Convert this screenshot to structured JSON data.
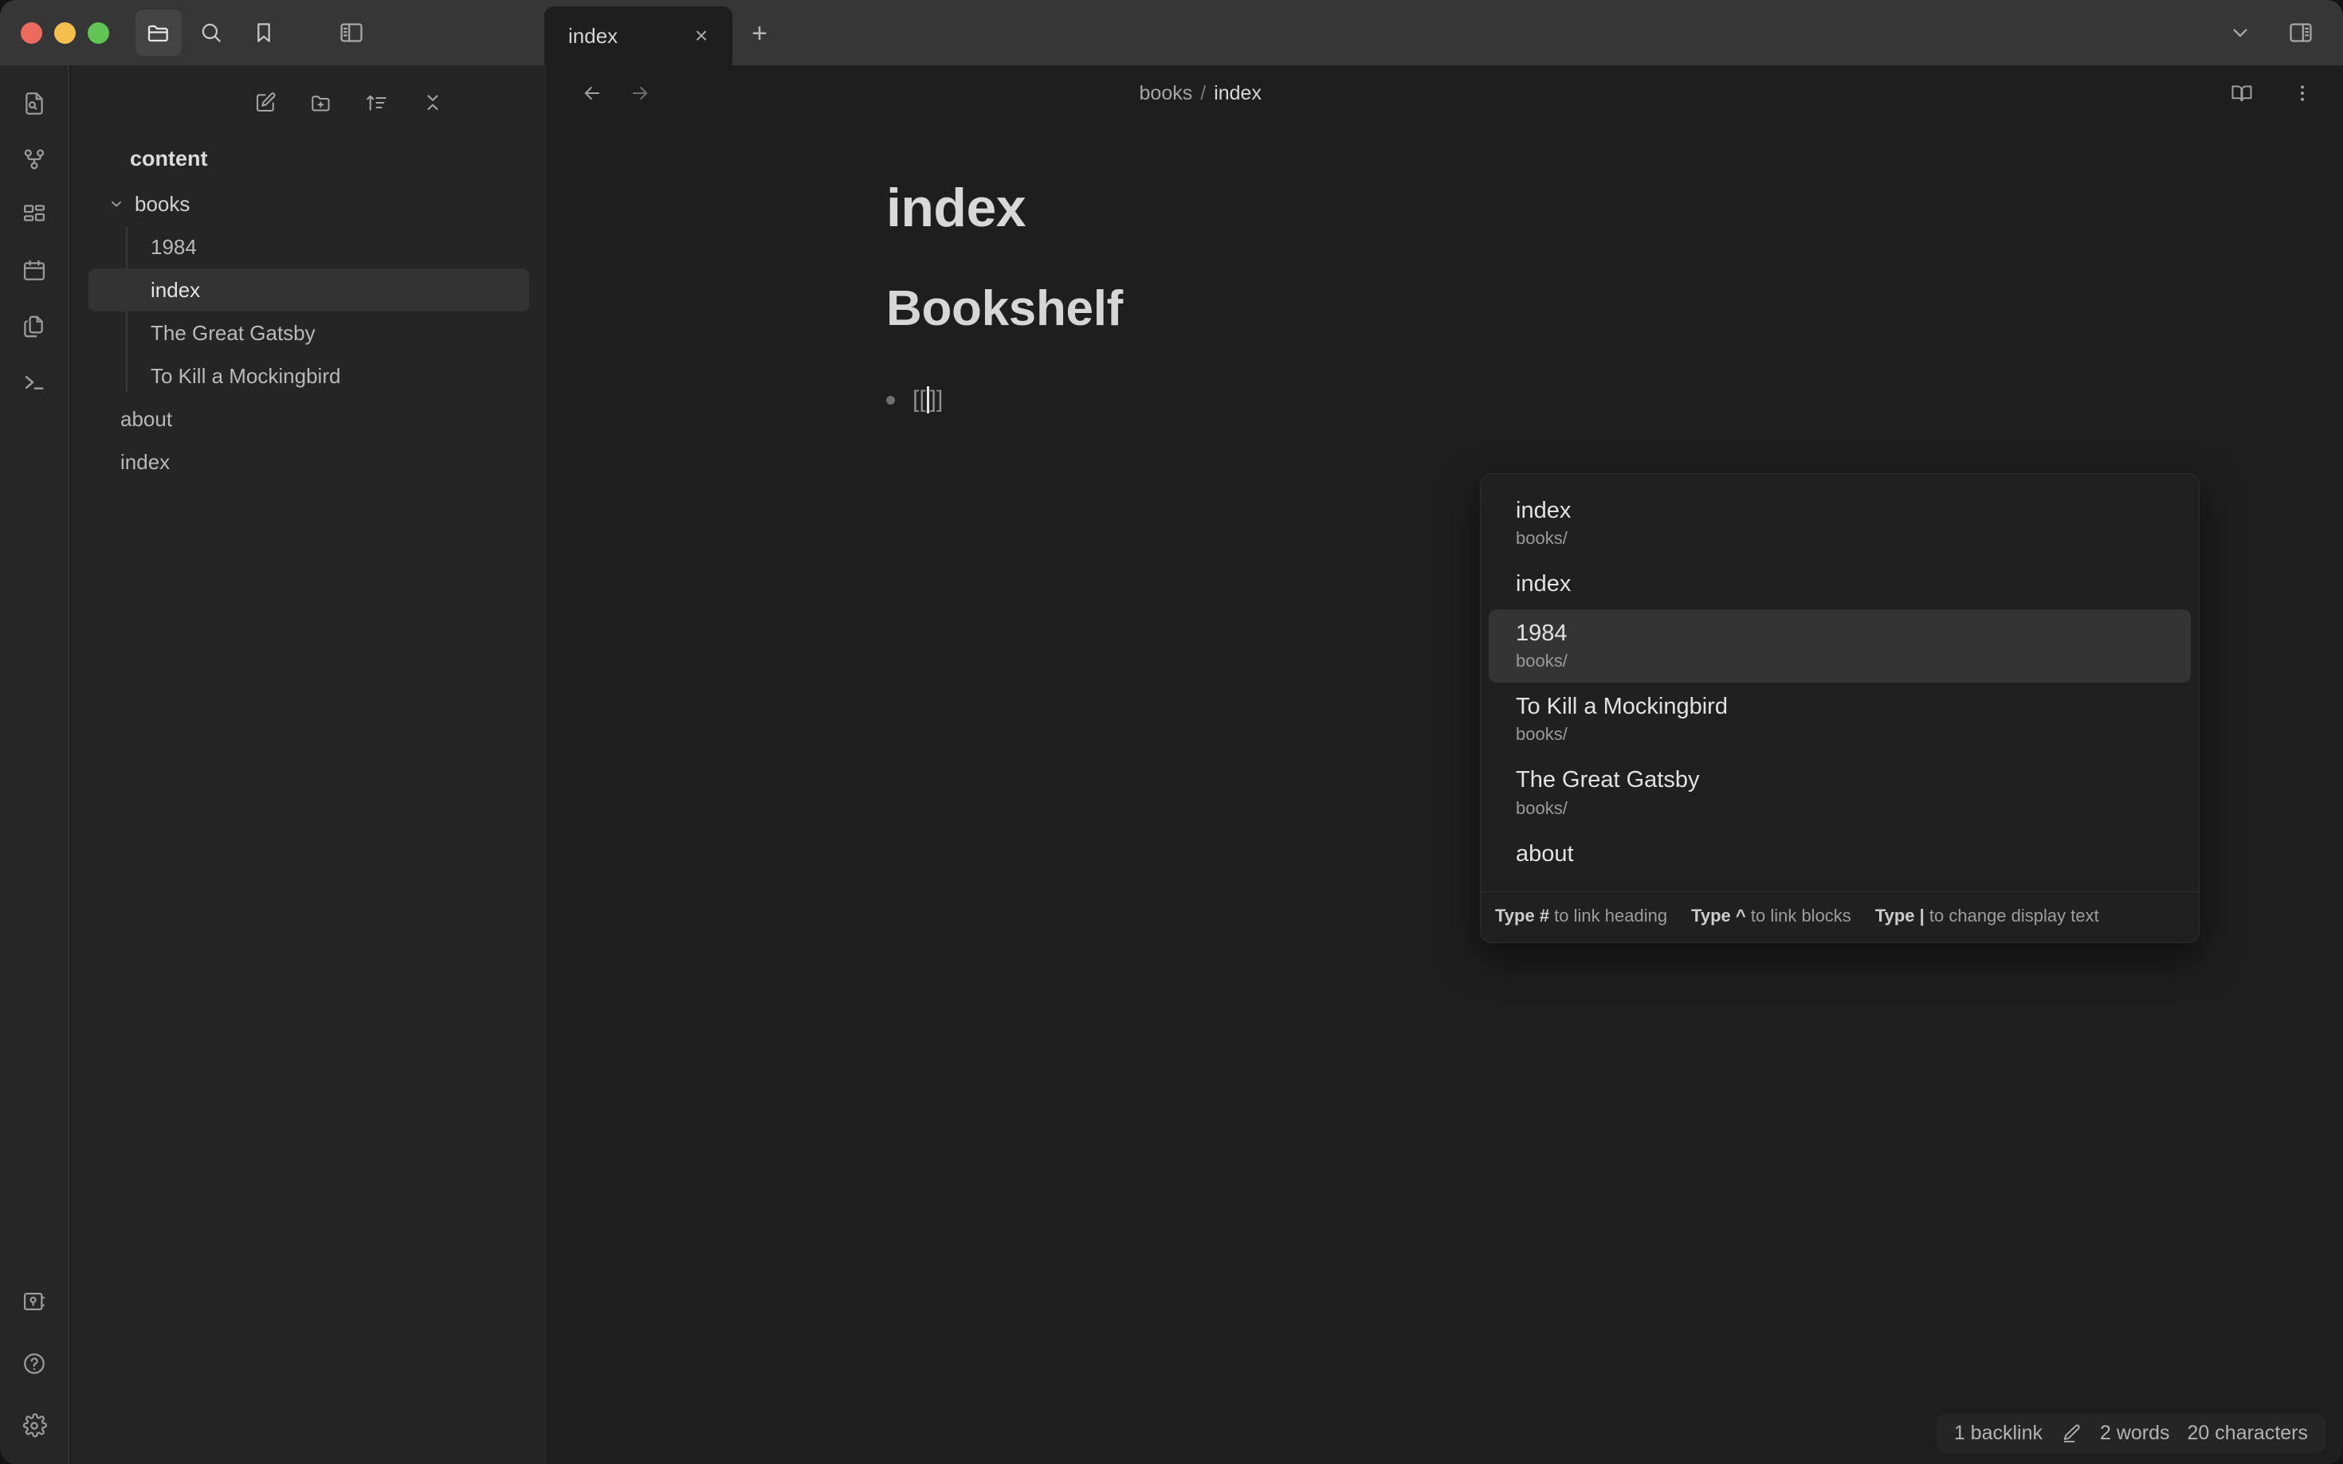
{
  "window": {
    "traffic_lights": [
      {
        "name": "close",
        "color": "#ED6A5E"
      },
      {
        "name": "minimize",
        "color": "#F5BF4F"
      },
      {
        "name": "zoom",
        "color": "#61C454"
      }
    ],
    "titlebar_icons": [
      {
        "name": "folder-icon",
        "label": "Files",
        "active": true
      },
      {
        "name": "search-icon",
        "label": "Search",
        "active": false
      },
      {
        "name": "bookmark-icon",
        "label": "Bookmarks",
        "active": false
      }
    ],
    "left_sidebar_toggle": "left-sidebar-toggle-icon",
    "right_sidebar_toggle": "right-sidebar-toggle-icon",
    "tab_overflow": "chevron-down-icon"
  },
  "tabs": {
    "items": [
      {
        "label": "index",
        "active": true,
        "close": "×"
      }
    ],
    "new_tab_label": "+"
  },
  "ribbon": {
    "top_items": [
      {
        "name": "quick-switcher-icon",
        "label": "Quick switcher"
      },
      {
        "name": "graph-view-icon",
        "label": "Graph view"
      },
      {
        "name": "canvas-icon",
        "label": "Canvas"
      },
      {
        "name": "daily-note-icon",
        "label": "Daily note"
      },
      {
        "name": "templates-icon",
        "label": "Templates"
      },
      {
        "name": "terminal-icon",
        "label": "Terminal"
      }
    ],
    "bottom_items": [
      {
        "name": "vault-switcher-icon",
        "label": "Open another vault"
      },
      {
        "name": "help-icon",
        "label": "Help"
      },
      {
        "name": "settings-icon",
        "label": "Settings"
      }
    ]
  },
  "file_explorer": {
    "toolbar": [
      {
        "name": "new-note-icon",
        "label": "New note"
      },
      {
        "name": "new-folder-icon",
        "label": "New folder"
      },
      {
        "name": "sort-icon",
        "label": "Change sort order"
      },
      {
        "name": "collapse-all-icon",
        "label": "Collapse all"
      }
    ],
    "vault_name": "content",
    "tree": [
      {
        "type": "folder",
        "label": "books",
        "expanded": true,
        "children": [
          {
            "type": "file",
            "label": "1984",
            "selected": false
          },
          {
            "type": "file",
            "label": "index",
            "selected": true
          },
          {
            "type": "file",
            "label": "The Great Gatsby",
            "selected": false
          },
          {
            "type": "file",
            "label": "To Kill a Mockingbird",
            "selected": false
          }
        ]
      },
      {
        "type": "file",
        "label": "about",
        "selected": false
      },
      {
        "type": "file",
        "label": "index",
        "selected": false
      }
    ]
  },
  "view_header": {
    "back": {
      "name": "back-arrow-icon",
      "label": "Back"
    },
    "forward": {
      "name": "forward-arrow-icon",
      "label": "Forward"
    },
    "breadcrumb": {
      "folder": "books",
      "separator": "/",
      "file": "index"
    },
    "actions": [
      {
        "name": "reading-mode-icon",
        "label": "Reading view"
      },
      {
        "name": "more-options-icon",
        "label": "More options"
      }
    ]
  },
  "document": {
    "title": "index",
    "heading": "Bookshelf",
    "bullet": {
      "open_bracket": "[[",
      "close_bracket": "]]",
      "query": ""
    }
  },
  "suggestion_popup": {
    "items": [
      {
        "title": "index",
        "path": "books/",
        "selected": false
      },
      {
        "title": "index",
        "path": "",
        "selected": false
      },
      {
        "title": "1984",
        "path": "books/",
        "selected": true
      },
      {
        "title": "To Kill a Mockingbird",
        "path": "books/",
        "selected": false
      },
      {
        "title": "The Great Gatsby",
        "path": "books/",
        "selected": false
      },
      {
        "title": "about",
        "path": "",
        "selected": false
      }
    ],
    "hints": [
      {
        "key": "Type #",
        "text": " to link heading"
      },
      {
        "key": "Type ^",
        "text": " to link blocks"
      },
      {
        "key": "Type |",
        "text": " to change display text"
      }
    ]
  },
  "status_bar": {
    "backlinks": "1 backlink",
    "edit_icon": "pencil-icon",
    "words": "2 words",
    "characters": "20 characters"
  },
  "colors": {
    "titlebar_bg": "#363636",
    "ribbon_bg": "#262626",
    "sidebar_bg": "#252525",
    "editor_bg": "#1e1e1e",
    "popup_bg": "#202020",
    "selection_bg": "#343434",
    "text_primary": "#dcdcdc",
    "text_muted": "#9a9a9a"
  }
}
